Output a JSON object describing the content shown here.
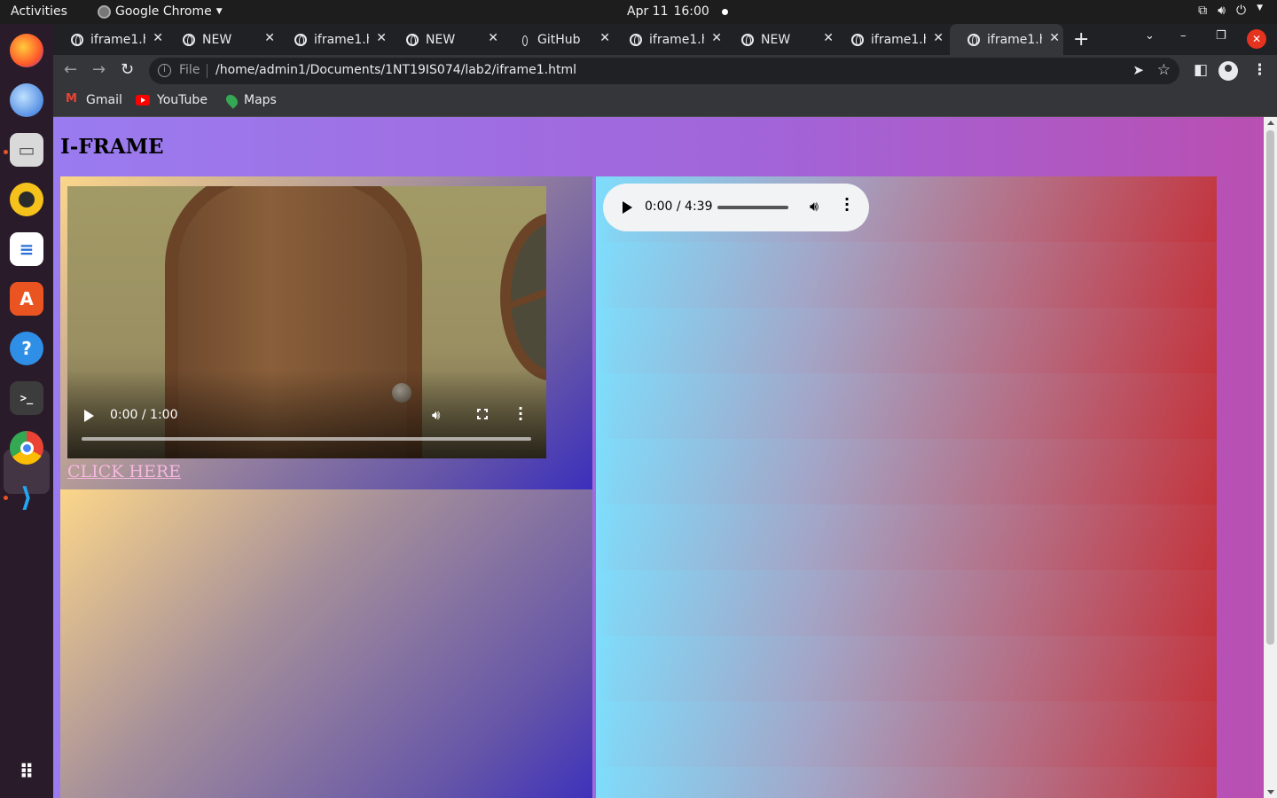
{
  "system": {
    "activities": "Activities",
    "app_menu": "Google Chrome",
    "date": "Apr 11",
    "time": "16:00"
  },
  "dock": {
    "apps": [
      "firefox-icon",
      "thunderbird-icon",
      "files-icon",
      "rhythmbox-icon",
      "writer-icon",
      "software-icon",
      "help-icon",
      "terminal-icon",
      "chrome-icon",
      "vscode-icon",
      "show-apps-icon"
    ]
  },
  "tabs": [
    {
      "title": "iframe1.h",
      "active": false
    },
    {
      "title": "NEW",
      "active": false
    },
    {
      "title": "iframe1.h",
      "active": false
    },
    {
      "title": "NEW",
      "active": false
    },
    {
      "title": "GitHub",
      "active": false
    },
    {
      "title": "iframe1.h",
      "active": false
    },
    {
      "title": "NEW",
      "active": false
    },
    {
      "title": "iframe1.h",
      "active": false
    },
    {
      "title": "iframe1.h",
      "active": true
    }
  ],
  "omnibox": {
    "scheme": "File",
    "url": "/home/admin1/Documents/1NT19IS074/lab2/iframe1.html"
  },
  "bookmarks": [
    {
      "label": "Gmail",
      "icon": "gmail-icon"
    },
    {
      "label": "YouTube",
      "icon": "youtube-icon"
    },
    {
      "label": "Maps",
      "icon": "maps-icon"
    }
  ],
  "page": {
    "heading": "I-FRAME",
    "link_text": "CLICK HERE",
    "video": {
      "time": "0:00 / 1:00",
      "progress": 0
    },
    "audio": {
      "time": "0:00 / 4:39",
      "progress": 0
    }
  },
  "colors": {
    "accent_orange": "#e95420",
    "link": "#f5b8de",
    "close_button": "#e6331f"
  }
}
